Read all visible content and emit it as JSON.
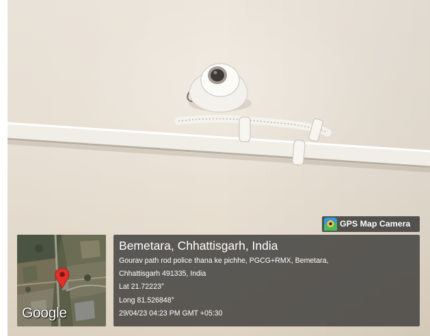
{
  "watermark": {
    "app_name": "GPS Map Camera",
    "map_attribution": "Google"
  },
  "location": {
    "title": "Bemetara, Chhattisgarh, India",
    "address_line_1": "Gourav path rod police thana ke pichhe, PGCG+RMX, Bemetara,",
    "address_line_2": "Chhattisgarh 491335, India",
    "latitude": "Lat 21.72223°",
    "longitude": "Long 81.526848°",
    "datetime": "29/04/23 04:23 PM GMT +05:30"
  },
  "icons": {
    "map_pin": "map-pin-icon",
    "app": "gps-map-camera-app-icon"
  },
  "colors": {
    "wall": "#ebe3d7",
    "panel": "#444240",
    "pin": "#e0322b",
    "text": "#ffffff"
  }
}
